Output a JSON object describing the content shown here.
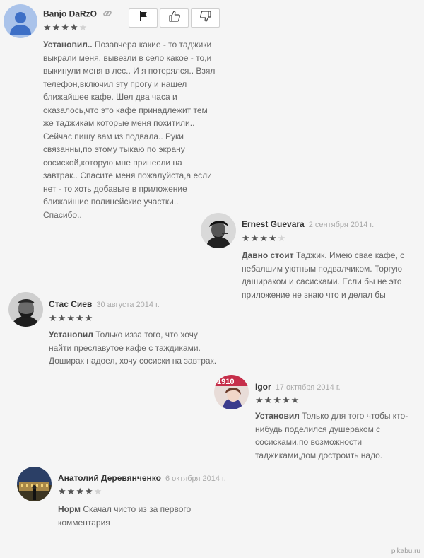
{
  "reviews": [
    {
      "author": "Banjo DaRzO",
      "date": "",
      "rating": 4,
      "title": "Установил..",
      "body": "Позавчера какие - то таджики выкрали меня, вывезли в село какое - то,и выкинули меня в лес.. И я потерялся.. Взял телефон,включил эту прогу и нашел ближайшее кафе. Шел два часа и оказалось,что это кафе принадлежит тем же таджикам которые меня похитили.. Сейчас пишу вам из подвала.. Руки связанны,по этому тыкаю по экрану сосиской,которую мне принесли на завтрак.. Спасите меня пожалуйста,а если нет - то хоть добавьте в приложение ближайшие полицейские участки.. Спасибо.."
    },
    {
      "author": "Ernest Guevara",
      "date": "2 сентября 2014 г.",
      "rating": 4,
      "title": "Давно стоит",
      "body": "Таджик. Имею свае кафе, с небалшим уютным подвалчиком. Торгую дашираком и сасисками. Если бы не это приложение не знаю что и делал бы"
    },
    {
      "author": "Стас Сиев",
      "date": "30 августа 2014 г.",
      "rating": 5,
      "title": "Установил",
      "body": "Только изза того, что хочу найти преславутое кафе с таждиками. Доширак надоел, хочу сосиски на завтрак."
    },
    {
      "author": "Igor",
      "date": "17 октября 2014 г.",
      "rating": 5,
      "title": "Установил",
      "body": "Только для того чтобы кто-нибудь поделился душераком с сосисками,по возможности таджиками,дом достроить надо."
    },
    {
      "author": "Анатолий Деревянченко",
      "date": "6 октября 2014 г.",
      "rating": 4,
      "title": "Норм",
      "body": "Скачал чисто из за первого комментария"
    }
  ],
  "watermark": "pikabu.ru",
  "colors": {
    "background": "#f5f5f5",
    "star_on": "#555555",
    "star_off": "#d2d2d2"
  }
}
